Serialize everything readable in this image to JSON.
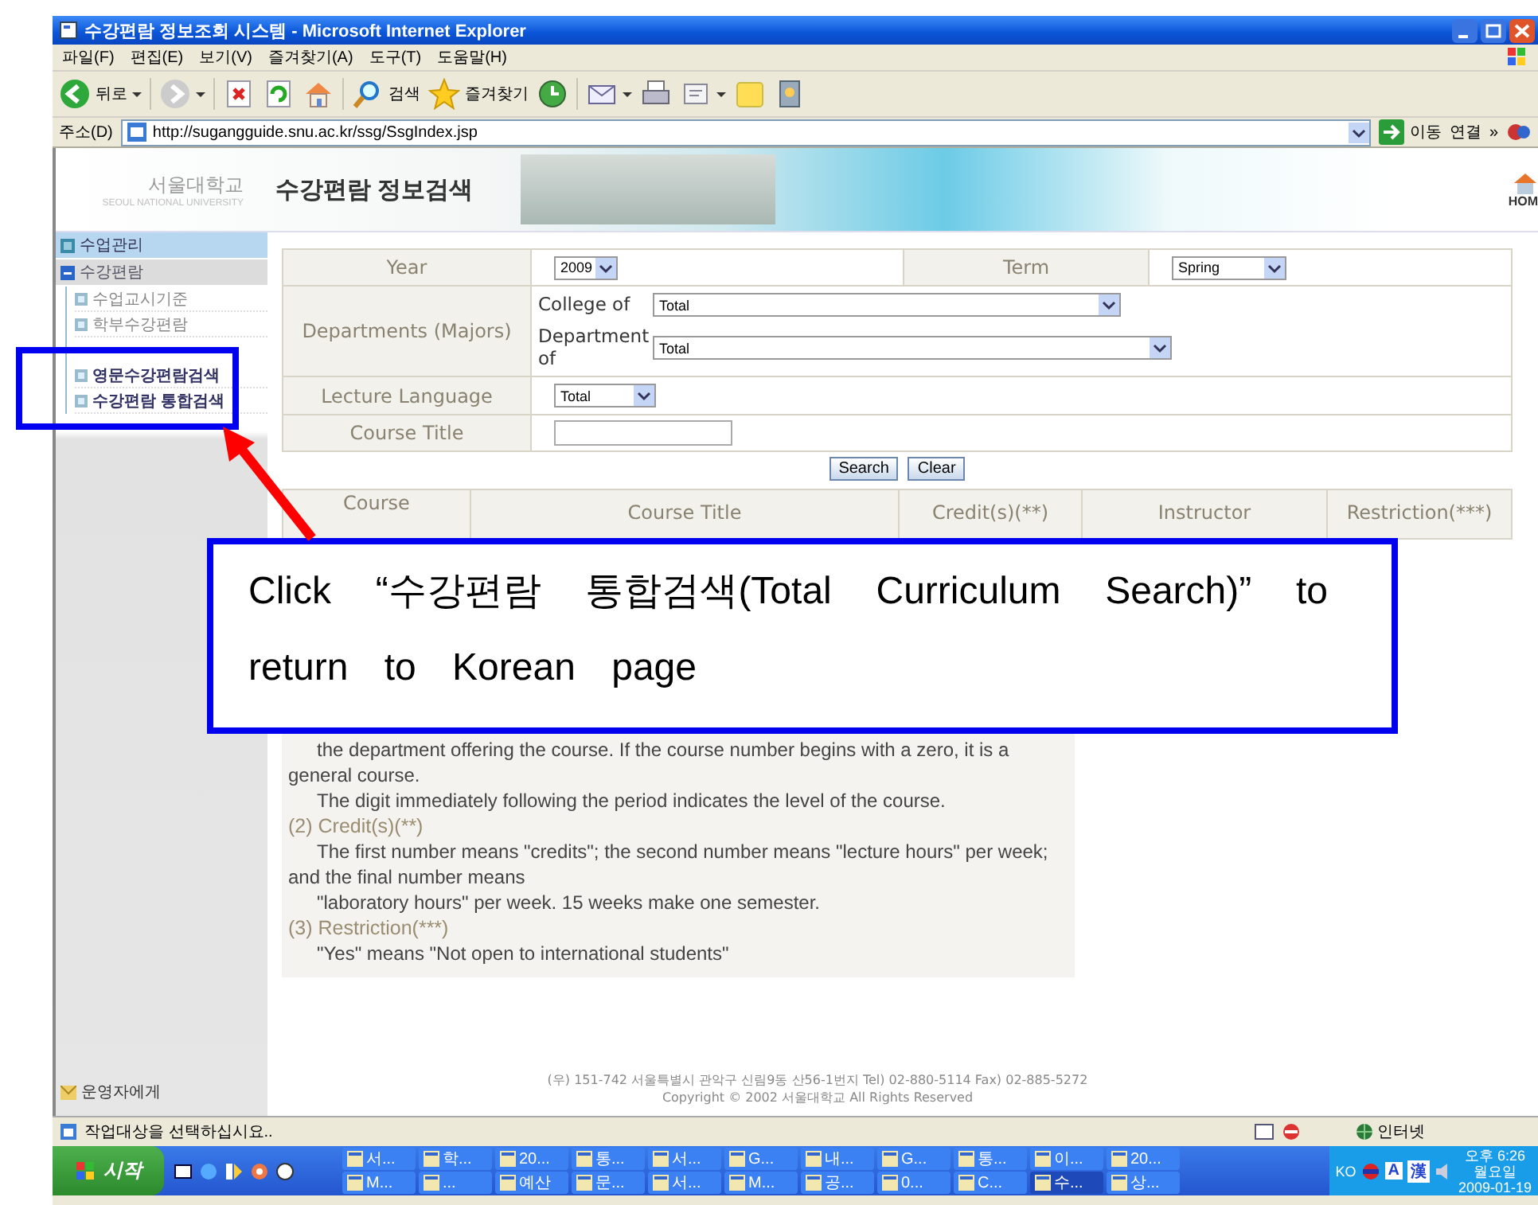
{
  "window": {
    "title": "수강편람 정보조회 시스템 - Microsoft Internet Explorer"
  },
  "menu": [
    "파일(F)",
    "편집(E)",
    "보기(V)",
    "즐겨찾기(A)",
    "도구(T)",
    "도움말(H)"
  ],
  "toolbar": [
    {
      "kind": "back",
      "label": "뒤로"
    },
    {
      "kind": "forward"
    },
    {
      "kind": "stop"
    },
    {
      "kind": "refresh"
    },
    {
      "kind": "home"
    },
    {
      "kind": "search",
      "label": "검색"
    },
    {
      "kind": "favorites",
      "label": "즐겨찾기"
    },
    {
      "kind": "history"
    },
    {
      "kind": "mail"
    },
    {
      "kind": "print"
    },
    {
      "kind": "edit"
    },
    {
      "kind": "folder"
    },
    {
      "kind": "messenger"
    }
  ],
  "address_bar": {
    "label": "주소(D)",
    "value": "http://sugangguide.snu.ac.kr/ssg/SsgIndex.jsp",
    "go": "이동",
    "links": "연결",
    "more": "»"
  },
  "header": {
    "logo_name": "서울대학교",
    "logo_sub": "SEOUL NATIONAL UNIVERSITY",
    "title": "수강편람 정보검색",
    "home": "HOM"
  },
  "sidebar": {
    "items": [
      {
        "label": "수업관리",
        "selected": true,
        "expanded": false
      },
      {
        "label": "수강편람",
        "selected": false,
        "expanded": true,
        "children": [
          {
            "label": "수업교시기준",
            "highlighted": false
          },
          {
            "label": "학부수강편람",
            "highlighted": false
          },
          {
            "label": "영문수강편람검색",
            "highlighted": true
          },
          {
            "label": "수강편람 통합검색",
            "highlighted": true
          }
        ]
      }
    ],
    "operator_link": "운영자에게"
  },
  "search_form": {
    "year": {
      "label": "Year",
      "value": "2009"
    },
    "term": {
      "label": "Term",
      "value": "Spring"
    },
    "departments": {
      "label": "Departments (Majors)",
      "college_label": "College of",
      "college_value": "Total",
      "department_label": "Department of",
      "department_value": "Total"
    },
    "language": {
      "label": "Lecture Language",
      "value": "Total"
    },
    "course_title": {
      "label": "Course Title"
    },
    "buttons": [
      "Search",
      "Clear"
    ]
  },
  "results": {
    "columns": [
      "Course",
      "Course Title",
      "Credit(s)(**)",
      "Instructor",
      "Restriction(***)"
    ]
  },
  "notes": [
    {
      "kind": "text",
      "text": "the department offering the course. If the course number begins with a zero, it is a general course."
    },
    {
      "kind": "text",
      "text": "The digit immediately following the period indicates the level of the course."
    },
    {
      "kind": "heading",
      "text": "(2) Credit(s)(**)"
    },
    {
      "kind": "text",
      "text": "The first number means \"credits\"; the second number means \"lecture hours\" per week; and the final number means"
    },
    {
      "kind": "text",
      "text": "\"laboratory hours\" per week. 15 weeks make one semester."
    },
    {
      "kind": "heading",
      "text": "(3) Restriction(***)"
    },
    {
      "kind": "text",
      "text": "\"Yes\" means \"Not open to international students\""
    }
  ],
  "footer": [
    "(우) 151-742 서울특별시 관악구 신림9동 산56-1번지 Tel) 02-880-5114  Fax) 02-885-5272",
    "Copyright © 2002 서울대학교 All Rights Reserved"
  ],
  "status_bar": {
    "message": "작업대상을 선택하십시요..",
    "zone": "인터넷"
  },
  "taskbar": {
    "start": "시작",
    "rows": [
      {
        "items": [
          {
            "label": "서...",
            "selected": false
          },
          {
            "label": "학...",
            "selected": false
          },
          {
            "label": "20...",
            "selected": false
          },
          {
            "label": "통...",
            "selected": false
          },
          {
            "label": "서...",
            "selected": false
          },
          {
            "label": "G...",
            "selected": false
          },
          {
            "label": "내...",
            "selected": false
          },
          {
            "label": "G...",
            "selected": false
          },
          {
            "label": "통...",
            "selected": false
          },
          {
            "label": "이...",
            "selected": false
          },
          {
            "label": "20...",
            "selected": false
          }
        ]
      },
      {
        "items": [
          {
            "label": "M...",
            "selected": false
          },
          {
            "label": "...",
            "selected": false
          },
          {
            "label": "예산",
            "selected": false
          },
          {
            "label": "문...",
            "selected": false
          },
          {
            "label": "서...",
            "selected": false
          },
          {
            "label": "M...",
            "selected": false
          },
          {
            "label": "공...",
            "selected": false
          },
          {
            "label": "0...",
            "selected": false
          },
          {
            "label": "C...",
            "selected": false
          },
          {
            "label": "수...",
            "selected": true
          },
          {
            "label": "상...",
            "selected": false
          }
        ]
      }
    ],
    "tray": {
      "ime": "KO",
      "mode": "A",
      "hanja": "漢",
      "time": "오후 6:26",
      "day": "월요일",
      "date": "2009-01-19"
    }
  },
  "annotation": {
    "callout": "Click “수강편람 통합검색(Total Curriculum Search)”  to return to Korean page"
  }
}
